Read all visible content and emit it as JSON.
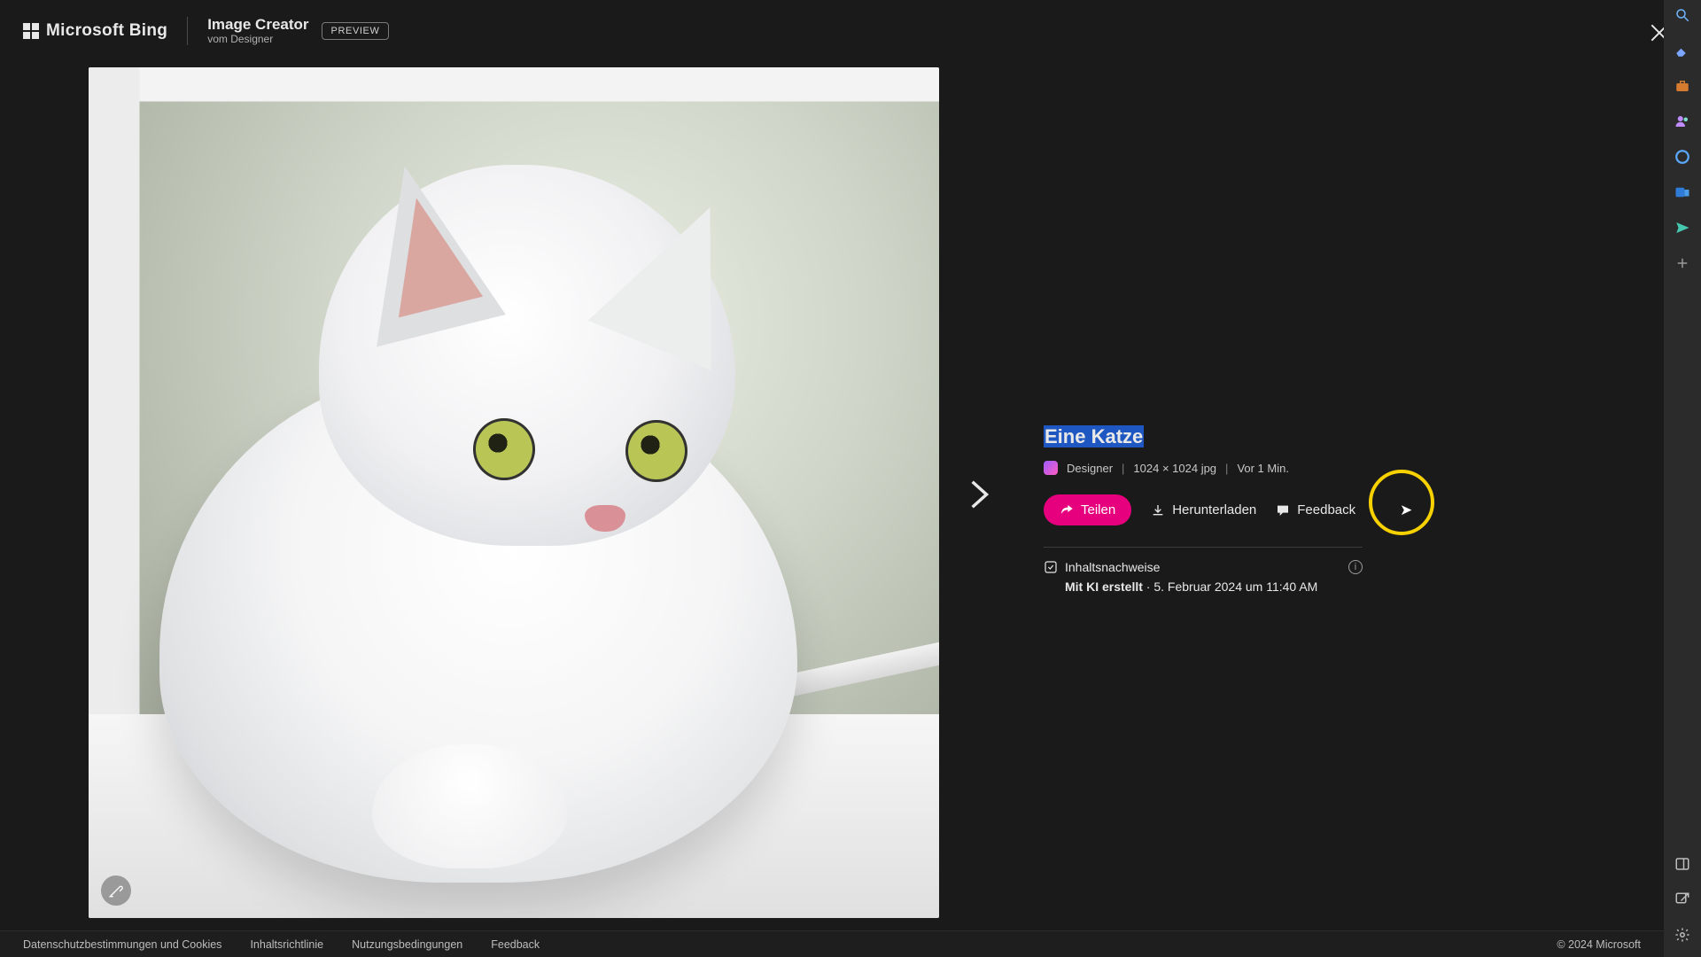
{
  "header": {
    "brand": "Microsoft Bing",
    "app_title": "Image Creator",
    "app_subtitle": "vom Designer",
    "preview_badge": "PREVIEW"
  },
  "image": {
    "alt": "Weiße Katze am Fenster",
    "watermark_icon": "ai-brush-icon"
  },
  "detail": {
    "prompt_title": "Eine Katze",
    "source_name": "Designer",
    "dimensions": "1024 × 1024 jpg",
    "age": "Vor 1 Min.",
    "actions": {
      "share_label": "Teilen",
      "download_label": "Herunterladen",
      "feedback_label": "Feedback"
    },
    "provenance": {
      "heading": "Inhaltsnachweise",
      "bold": "Mit KI erstellt",
      "timestamp": "5. Februar 2024 um 11:40 AM"
    }
  },
  "footer": {
    "links": {
      "privacy": "Datenschutzbestimmungen und Cookies",
      "content_policy": "Inhaltsrichtlinie",
      "terms": "Nutzungsbedingungen",
      "feedback": "Feedback"
    },
    "copyright": "© 2024 Microsoft"
  },
  "side_rail": {
    "icons": [
      "search-icon",
      "eraser-icon",
      "briefcase-icon",
      "people-icon",
      "office-icon",
      "outlook-icon",
      "send-icon",
      "plus-icon"
    ],
    "bottom_icons": [
      "panel-icon",
      "open-icon",
      "settings-icon"
    ]
  }
}
